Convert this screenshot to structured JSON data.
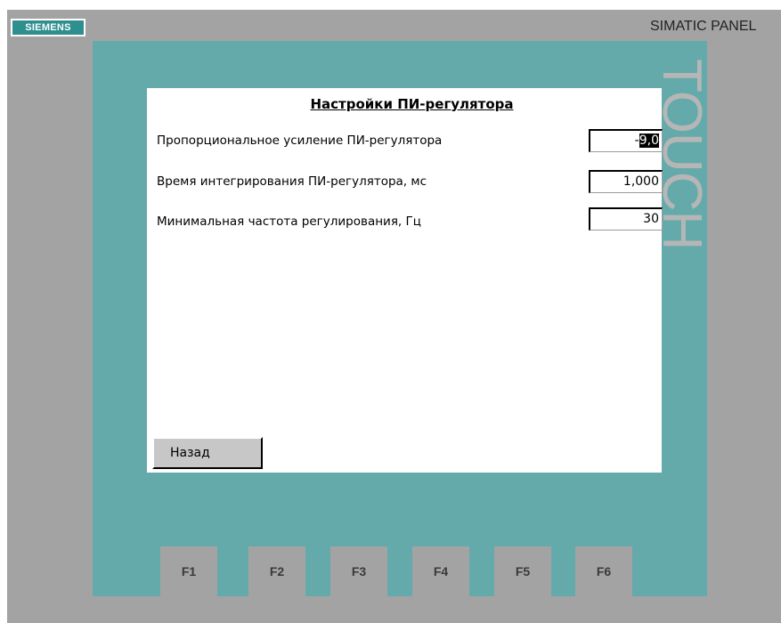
{
  "device": {
    "brand": "SIEMENS",
    "model": "SIMATIC PANEL",
    "bezel_text": "TOUCH",
    "colors": {
      "frame": "#a3a3a3",
      "bezel": "#64aaab",
      "brand_badge": "#2f8f8f",
      "screen": "#ffffff"
    }
  },
  "screen": {
    "title": "Настройки ПИ-регулятора",
    "rows": [
      {
        "label": "Пропорциональное усиление ПИ-регулятора",
        "value": "9,0",
        "prefix": "-"
      },
      {
        "label": "Время интегрирования ПИ-регулятора, мс",
        "value": "1,000"
      },
      {
        "label": "Минимальная частота регулирования, Гц",
        "value": "30"
      }
    ],
    "back_button": "Назад"
  },
  "function_keys": [
    "F1",
    "F2",
    "F3",
    "F4",
    "F5",
    "F6"
  ]
}
